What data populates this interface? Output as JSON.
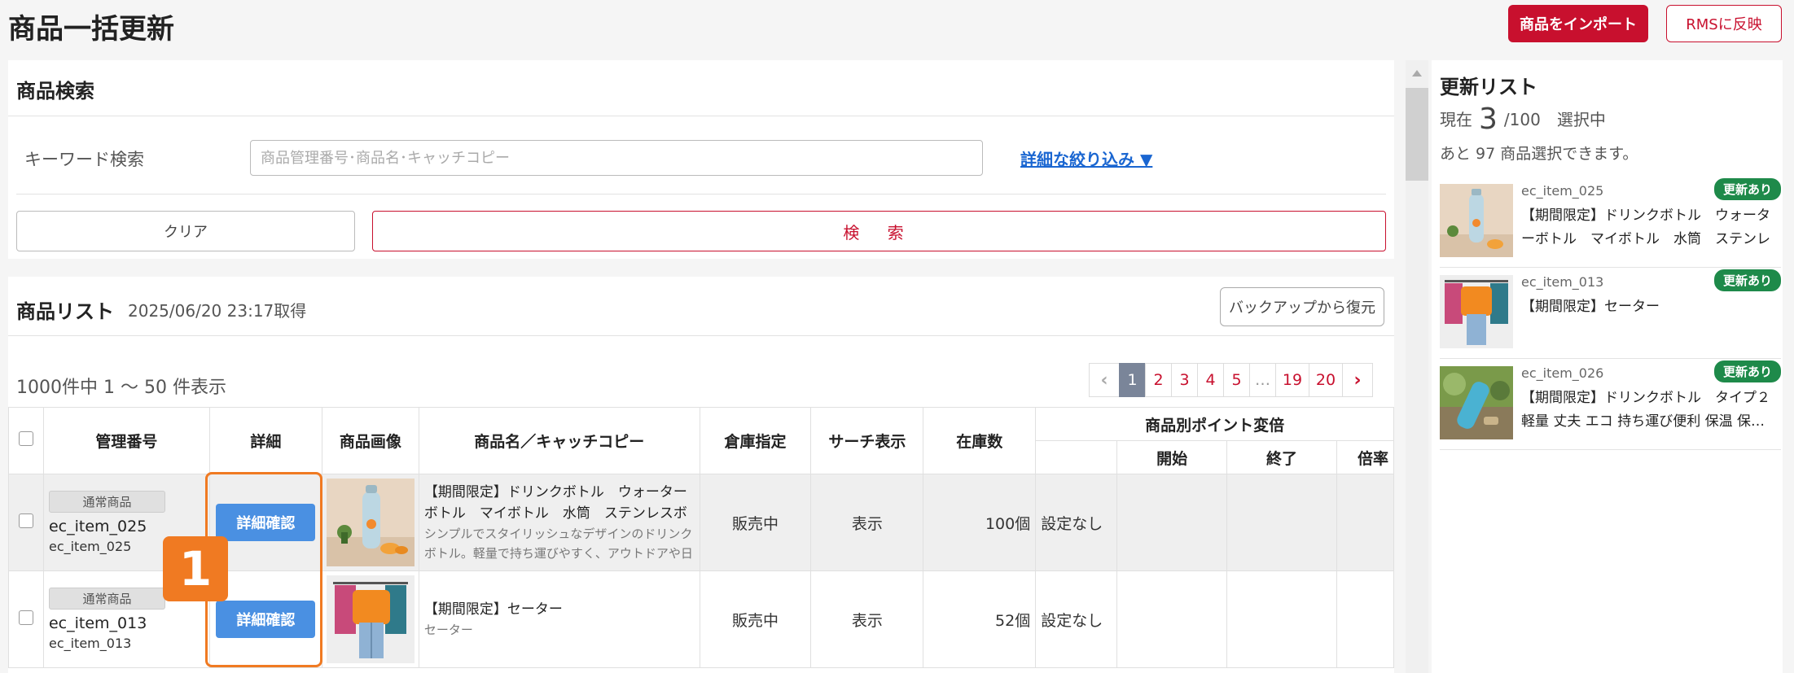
{
  "page": {
    "title": "商品一括更新"
  },
  "header": {
    "import_label": "商品をインポート",
    "rms_label": "RMSに反映"
  },
  "search": {
    "title": "商品検索",
    "keyword_label": "キーワード検索",
    "placeholder": "商品管理番号･商品名･キャッチコピー",
    "value": "",
    "advanced_label": "詳細な絞り込み ▼",
    "clear_label": "クリア",
    "search_label": "検 索"
  },
  "list": {
    "title": "商品リスト",
    "fetched": "2025/06/20 23:17取得",
    "backup_label": "バックアップから復元",
    "count_text": "1000件中 1 〜 50 件表示",
    "pagination": {
      "prev": "‹",
      "pages": [
        "1",
        "2",
        "3",
        "4",
        "5",
        "…",
        "19",
        "20"
      ],
      "next": "›",
      "current": "1"
    },
    "columns": {
      "id": "管理番号",
      "detail": "詳細",
      "image": "商品画像",
      "name": "商品名／キャッチコピー",
      "warehouse": "倉庫指定",
      "search_display": "サーチ表示",
      "stock": "在庫数",
      "points": "商品別ポイント変倍",
      "start": "開始",
      "end": "終了",
      "rate": "倍率"
    },
    "rows": [
      {
        "type": "通常商品",
        "id": "ec_item_025",
        "sub_id": "ec_item_025",
        "detail_label": "詳細確認",
        "name": "【期間限定】ドリンクボトル　ウォーターボトル　マイボトル　水筒　ステンレスボトル　アウ…",
        "description": "シンプルでスタイリッシュなデザインのドリンクボトル。軽量で持ち運びやすく、アウトドアや日常使いに…",
        "warehouse": "販売中",
        "search_display": "表示",
        "stock": "100個",
        "points": "設定なし"
      },
      {
        "type": "通常商品",
        "id": "ec_item_013",
        "sub_id": "ec_item_013",
        "detail_label": "詳細確認",
        "name": "【期間限定】セーター",
        "description": "セーター",
        "warehouse": "販売中",
        "search_display": "表示",
        "stock": "52個",
        "points": "設定なし"
      }
    ]
  },
  "annotation": {
    "step": "1",
    "color": "#f07a22"
  },
  "update_list": {
    "title": "更新リスト",
    "prefix": "現在",
    "current": "3",
    "max": "/100",
    "suffix": "選択中",
    "remaining": "あと 97 商品選択できます。",
    "items": [
      {
        "id": "ec_item_025",
        "tag": "更新あり",
        "name": "【期間限定】ドリンクボトル　ウォーターボトル　マイボトル　水筒　ステンレスボト…"
      },
      {
        "id": "ec_item_013",
        "tag": "更新あり",
        "name": "【期間限定】セーター"
      },
      {
        "id": "ec_item_026",
        "tag": "更新あり",
        "name": "【期間限定】ドリンクボトル　タイプ２　軽量 丈夫 エコ 持ち運び便利 保温 保…"
      }
    ]
  },
  "colors": {
    "brand": "#c8102e",
    "primary_button": "#4a90e2",
    "tag_green": "#1e8a4a",
    "link": "#1a66d1"
  }
}
